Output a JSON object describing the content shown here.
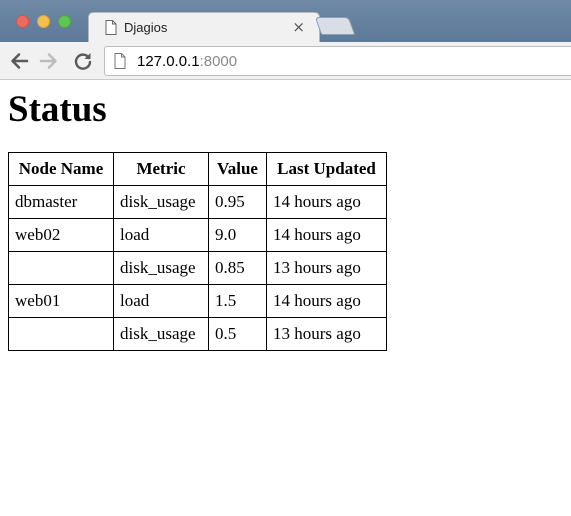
{
  "browser": {
    "tab_title": "Djagios",
    "tab_close": "×",
    "url_host": "127.0.0.1",
    "url_port": ":8000"
  },
  "page": {
    "heading": "Status",
    "table": {
      "headers": [
        "Node Name",
        "Metric",
        "Value",
        "Last Updated"
      ],
      "rows": [
        {
          "node": "dbmaster",
          "metric": "disk_usage",
          "value": "0.95",
          "updated": "14 hours ago"
        },
        {
          "node": "web02",
          "metric": "load",
          "value": "9.0",
          "updated": "14 hours ago"
        },
        {
          "node": "",
          "metric": "disk_usage",
          "value": "0.85",
          "updated": "13 hours ago"
        },
        {
          "node": "web01",
          "metric": "load",
          "value": "1.5",
          "updated": "14 hours ago"
        },
        {
          "node": "",
          "metric": "disk_usage",
          "value": "0.5",
          "updated": "13 hours ago"
        }
      ]
    }
  }
}
